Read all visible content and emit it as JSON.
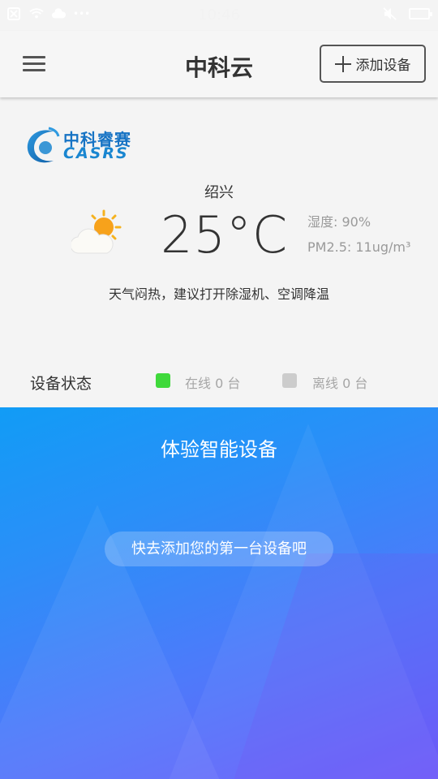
{
  "status_bar": {
    "time": "10:46",
    "icons": [
      "sim-card-icon",
      "wifi-icon",
      "cloud-icon",
      "more-dots-icon",
      "mute-icon",
      "battery-icon"
    ],
    "more_dots": "•••"
  },
  "header": {
    "title": "中科云",
    "add_button_label": "添加设备"
  },
  "logo": {
    "cn_text": "中科睿赛",
    "en_text": "CASRS"
  },
  "weather": {
    "city": "绍兴",
    "temperature": "25°C",
    "humidity": "湿度: 90%",
    "pm25": "PM2.5: 11ug/m³",
    "advice": "天气闷热，建议打开除湿机、空调降温",
    "icon": "partly-cloudy-icon"
  },
  "device_status": {
    "label": "设备状态",
    "online": "在线 0 台",
    "offline": "离线 0 台",
    "online_color": "#3fd93b",
    "offline_color": "#cccccc"
  },
  "promo": {
    "title": "体验智能设备",
    "button": "快去添加您的第一台设备吧"
  }
}
